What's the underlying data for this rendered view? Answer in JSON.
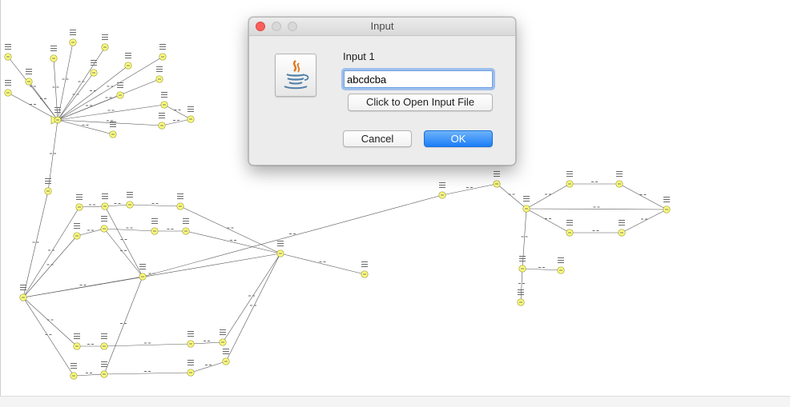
{
  "window": {
    "title": "Input",
    "buttons": [
      "close",
      "minimize",
      "maximize"
    ]
  },
  "dialog": {
    "icon": "java-cup-icon",
    "field_label": "Input 1",
    "input_value": "abcdcba",
    "file_button_label": "Click to Open Input File",
    "cancel_label": "Cancel",
    "ok_label": "OK"
  },
  "background": {
    "content": "graph-visualization",
    "node_color": "#fdfd7a"
  }
}
